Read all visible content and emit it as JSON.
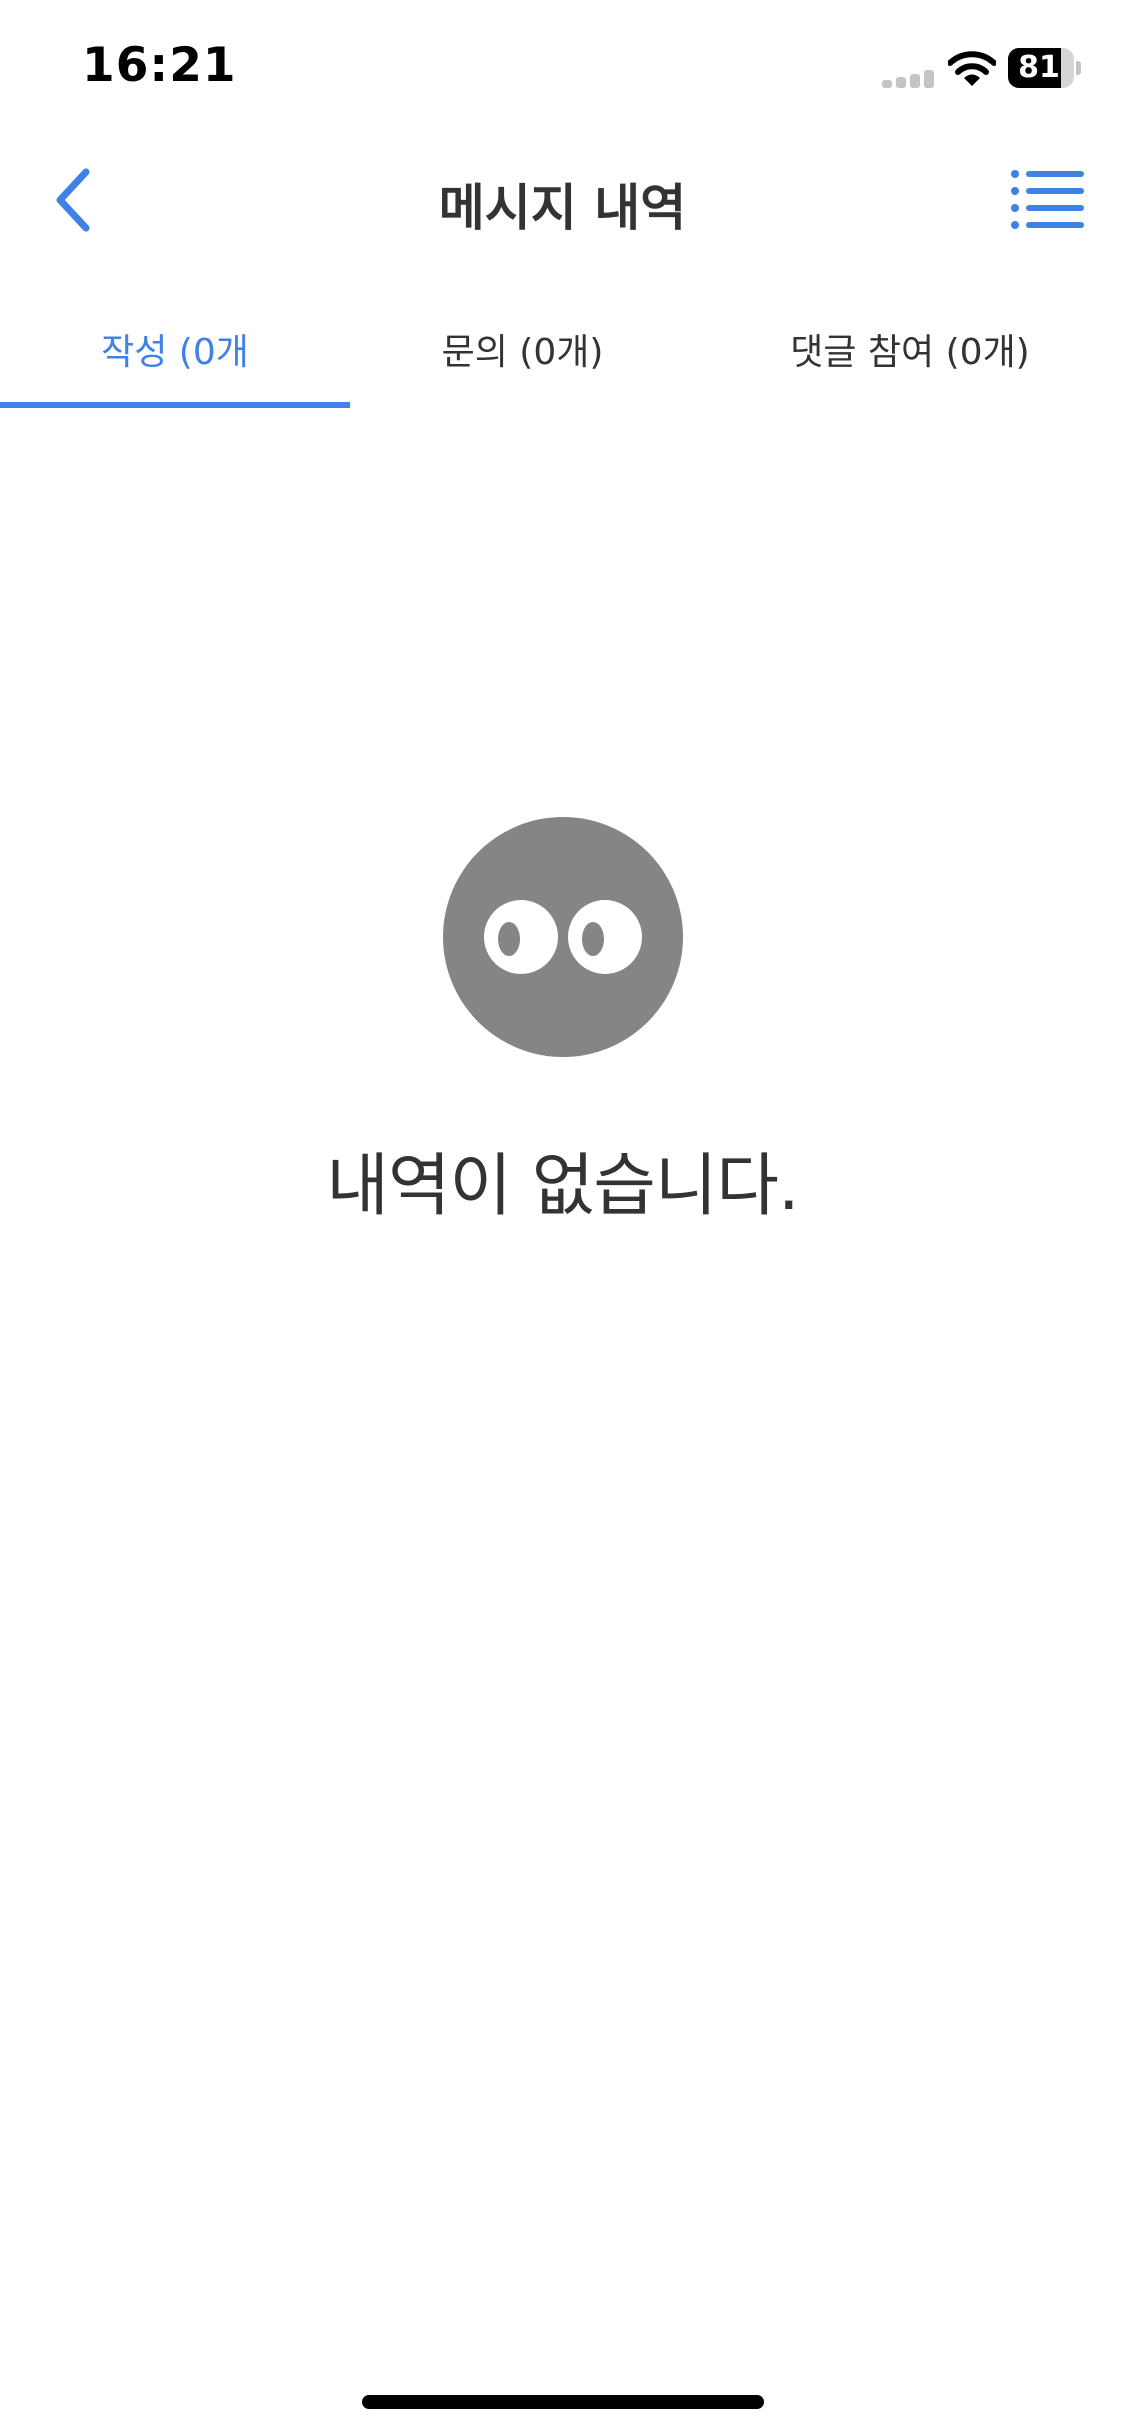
{
  "status_bar": {
    "time": "16:21",
    "battery_percent": "81",
    "battery_level": 0.81
  },
  "header": {
    "title": "메시지 내역",
    "back_icon": "chevron-left-icon",
    "menu_icon": "list-icon"
  },
  "tabs": [
    {
      "label": "작성 (0개",
      "active": true
    },
    {
      "label": "문의 (0개)",
      "active": false
    },
    {
      "label": "댓글 참여 (0개)",
      "active": false
    }
  ],
  "empty_state": {
    "icon": "eyes-face-icon",
    "message": "내역이 없습니다."
  },
  "colors": {
    "accent": "#3d82e4",
    "text": "#333333",
    "icon_gray": "#858585",
    "background": "#ffffff"
  }
}
